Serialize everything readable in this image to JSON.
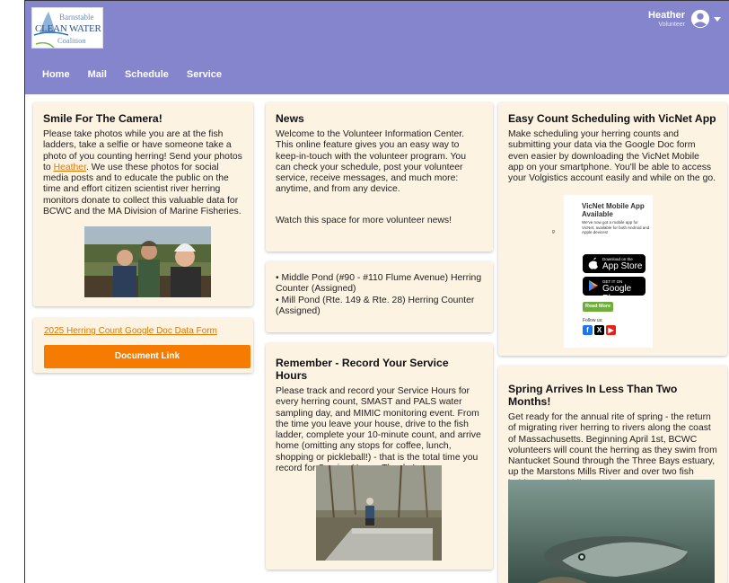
{
  "header": {
    "logo": {
      "line1": "Barnstable",
      "line2": "CLEAN WATER",
      "line3": "Coalition"
    },
    "user": {
      "name": "Heather",
      "role": "Volunteer"
    },
    "nav": [
      {
        "label": "Home"
      },
      {
        "label": "Mail"
      },
      {
        "label": "Schedule"
      },
      {
        "label": "Service"
      }
    ],
    "bar_color": "#8585cd"
  },
  "left": {
    "camera": {
      "title": "Smile For The Camera!",
      "body_1": "Please take photos while you are at the fish ladders, take a selfie or have someone take a photo of you counting herring! Send your photos to ",
      "link": "Heather",
      "body_2": ". We use these photos for social media posts and to educate the public on the time and effort citizen scientist river herring monitors donate to collect this valuable data for BCWC and the MA Division of Marine Fisheries."
    },
    "form": {
      "link": "2025 Herring Count Google Doc Data Form",
      "button": "Document Link"
    }
  },
  "middle": {
    "news": {
      "title": "News",
      "body": "Welcome to the Volunteer Information Center. This online feature gives you an easy way to keep-in-touch with the volunteer program. You can check your schedule, post your volunteer service, receive messages, and much more: anytime, and from any device.",
      "footer": "Watch this space for more volunteer news!"
    },
    "assignments": [
      "Middle Pond (#90 - #110 Flume Avenue) Herring Counter (Assigned)",
      "Mill Pond (Rte. 149 & Rte. 28) Herring Counter (Assigned)"
    ],
    "hours": {
      "title": "Remember - Record Your Service Hours",
      "body": "Please track and record your Service Hours for every herring count, SMAST and PALS water sampling day, and MIMIC monitoring event. From the time you leave your house, drive to the fish ladder, complete your 10-minute count, and arrive home (omitting any stops for coffee, lunch, shopping or pickleball!) - that is the total time you record for Service Hours. Thanks!"
    }
  },
  "right": {
    "vicnet": {
      "title": "Easy Count Scheduling with VicNet App",
      "body": "Make scheduling your herring counts and submitting your data via the Google Doc form even easier by downloading the VicNet Mobile app on your smartphone. You'll be able to access your Volgistics account easily and while on the go.",
      "ad": {
        "title_1": "VicNet Mobile App",
        "title_2": "Available",
        "sub": "We've now got a mobile app for VicNet, available for both Android and Apple devices!",
        "appstore_small": "Download on the",
        "appstore_big": "App Store",
        "play_small": "GET IT ON",
        "play_big": "Google Play",
        "read_more": "Read More",
        "follow": "Follow us:",
        "side_glyph": "g"
      }
    },
    "spring": {
      "title": "Spring Arrives In Less Than Two Months!",
      "body": "Get ready for the annual rite of spring - the return of migrating river herring to rivers along the coast of Massachusetts. Beginning April 1st, BCWC volunteers will count the herring as they swim from Nantucket Sound through the Three Bays estuary, up the Marstons Mills River and over two fish ladders into Middle Pond."
    }
  },
  "colors": {
    "card": "#fdf3e2",
    "accent": "#f57c00",
    "link": "#e07800"
  }
}
